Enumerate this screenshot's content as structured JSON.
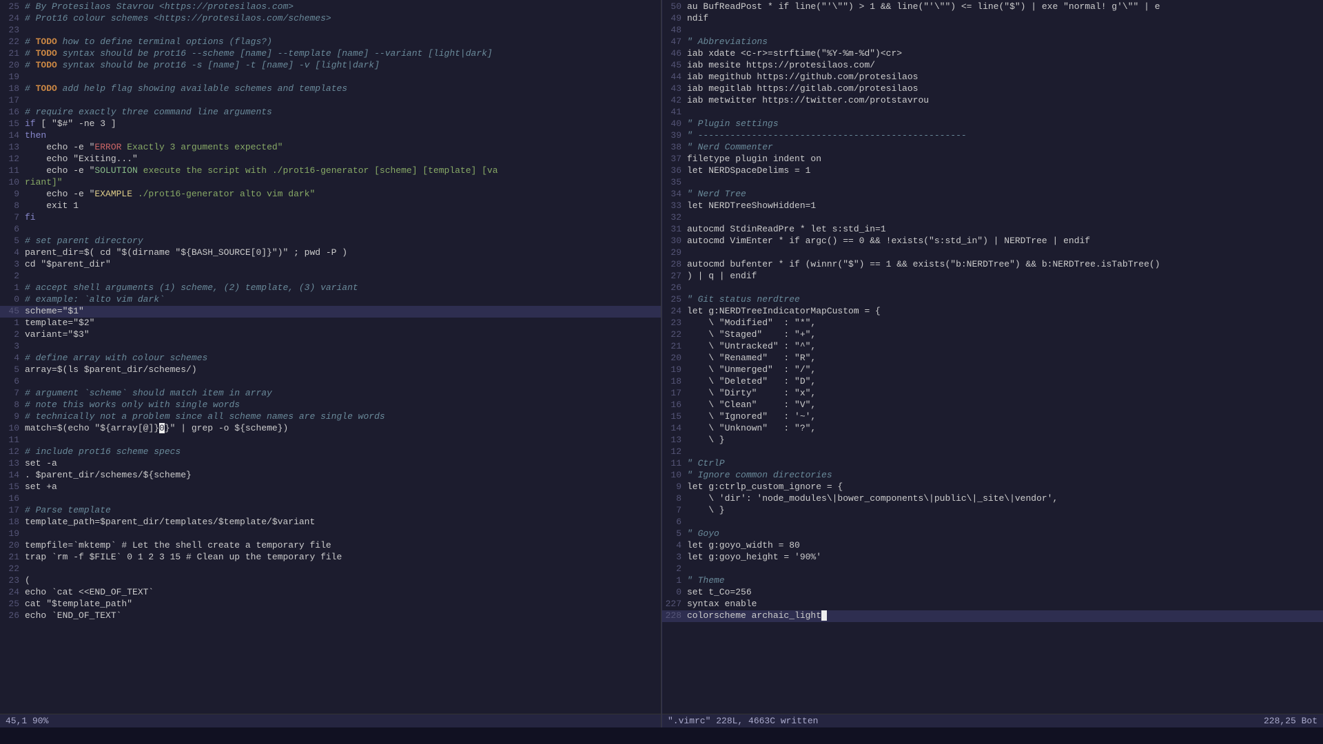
{
  "editor": {
    "left_pane": {
      "lines": [
        {
          "num": 25,
          "content": [
            {
              "t": "# By Protesilaos Stavrou <https://protesilaos.com>",
              "c": "c-comment"
            }
          ]
        },
        {
          "num": 24,
          "content": [
            {
              "t": "# Prot16 colour schemes <https://protesilaos.com/schemes>",
              "c": "c-comment"
            }
          ]
        },
        {
          "num": 23,
          "content": []
        },
        {
          "num": 22,
          "content": [
            {
              "t": "# ",
              "c": "c-comment"
            },
            {
              "t": "TODO",
              "c": "c-todo"
            },
            {
              "t": " how to define terminal options (flags?)",
              "c": "c-comment"
            }
          ]
        },
        {
          "num": 21,
          "content": [
            {
              "t": "# ",
              "c": "c-comment"
            },
            {
              "t": "TODO",
              "c": "c-todo"
            },
            {
              "t": " syntax should be prot16 --scheme [name] --template [name] --variant [light|dark]",
              "c": "c-comment"
            }
          ]
        },
        {
          "num": 20,
          "content": [
            {
              "t": "# ",
              "c": "c-comment"
            },
            {
              "t": "TODO",
              "c": "c-todo"
            },
            {
              "t": " syntax should be prot16 -s [name] -t [name] -v [light|dark]",
              "c": "c-comment"
            }
          ]
        },
        {
          "num": 19,
          "content": []
        },
        {
          "num": 18,
          "content": [
            {
              "t": "# ",
              "c": "c-comment"
            },
            {
              "t": "TODO",
              "c": "c-todo"
            },
            {
              "t": " add help flag showing available schemes and templates",
              "c": "c-comment"
            }
          ]
        },
        {
          "num": 17,
          "content": []
        },
        {
          "num": 16,
          "content": [
            {
              "t": "# require exactly three command line arguments",
              "c": "c-comment"
            }
          ]
        },
        {
          "num": 15,
          "content": [
            {
              "t": "if",
              "c": "c-keyword"
            },
            {
              "t": " [ \"$#\" -ne 3 ]",
              "c": "c-white"
            }
          ]
        },
        {
          "num": 14,
          "content": [
            {
              "t": "then",
              "c": "c-keyword"
            }
          ]
        },
        {
          "num": 13,
          "content": [
            {
              "t": "    echo -e \"",
              "c": "c-white"
            },
            {
              "t": "ERROR",
              "c": "c-red"
            },
            {
              "t": " Exactly 3 arguments expected\"",
              "c": "c-string"
            }
          ]
        },
        {
          "num": 12,
          "content": [
            {
              "t": "    echo \"Exiting...\"",
              "c": "c-white"
            }
          ]
        },
        {
          "num": 11,
          "content": [
            {
              "t": "    echo -e \"",
              "c": "c-white"
            },
            {
              "t": "SOLUTION",
              "c": "c-green"
            },
            {
              "t": " execute the script with ./prot16-generator [scheme] [template] [va",
              "c": "c-string"
            }
          ]
        },
        {
          "num": 10,
          "content": [
            {
              "t": "riant]\"",
              "c": "c-string"
            }
          ]
        },
        {
          "num": 9,
          "content": [
            {
              "t": "    echo -e \"",
              "c": "c-white"
            },
            {
              "t": "EXAMPLE",
              "c": "c-yellow"
            },
            {
              "t": " ./prot16-generator alto vim dark\"",
              "c": "c-string"
            }
          ]
        },
        {
          "num": 8,
          "content": [
            {
              "t": "    exit 1",
              "c": "c-white"
            }
          ]
        },
        {
          "num": 7,
          "content": [
            {
              "t": "fi",
              "c": "c-keyword"
            }
          ]
        },
        {
          "num": 6,
          "content": []
        },
        {
          "num": 5,
          "content": [
            {
              "t": "# set parent directory",
              "c": "c-comment"
            }
          ]
        },
        {
          "num": 4,
          "content": [
            {
              "t": "parent_dir=$( cd \"$(dirname \"${BASH_SOURCE[0]}\")\" ; pwd -P )",
              "c": "c-white"
            }
          ]
        },
        {
          "num": 3,
          "content": [
            {
              "t": "cd \"$parent_dir\"",
              "c": "c-white"
            }
          ]
        },
        {
          "num": 2,
          "content": []
        },
        {
          "num": 1,
          "content": [
            {
              "t": "# accept shell arguments (1) scheme, (2) template, (3) variant",
              "c": "c-comment"
            }
          ]
        },
        {
          "num": 0,
          "content": [
            {
              "t": "# example: `alto vim dark`",
              "c": "c-comment"
            }
          ]
        },
        {
          "num": 45,
          "highlight": true,
          "content": [
            {
              "t": "scheme=\"$1\"",
              "c": "c-white"
            }
          ]
        },
        {
          "num": 1,
          "content": [
            {
              "t": "template=\"$2\"",
              "c": "c-white"
            }
          ]
        },
        {
          "num": 2,
          "content": [
            {
              "t": "variant=\"$3\"",
              "c": "c-white"
            }
          ]
        },
        {
          "num": 3,
          "content": []
        },
        {
          "num": 4,
          "content": [
            {
              "t": "# define array with colour schemes",
              "c": "c-comment"
            }
          ]
        },
        {
          "num": 5,
          "content": [
            {
              "t": "array=$(ls $parent_dir/schemes/)",
              "c": "c-white"
            }
          ]
        },
        {
          "num": 6,
          "content": []
        },
        {
          "num": 7,
          "content": [
            {
              "t": "# argument `scheme` should match item in array",
              "c": "c-comment"
            }
          ]
        },
        {
          "num": 8,
          "content": [
            {
              "t": "# note this works only with single words",
              "c": "c-comment"
            }
          ]
        },
        {
          "num": 9,
          "content": [
            {
              "t": "# technically not a problem since all scheme names are single words",
              "c": "c-comment"
            }
          ]
        },
        {
          "num": 10,
          "content": [
            {
              "t": "match=$(echo \"${array[@]}",
              "c": "c-white"
            },
            {
              "t": "0",
              "c": "c-cursor"
            },
            {
              "t": "}\" | grep -o ${scheme})",
              "c": "c-white"
            }
          ]
        },
        {
          "num": 11,
          "content": []
        },
        {
          "num": 12,
          "content": [
            {
              "t": "# include prot16 scheme specs",
              "c": "c-comment"
            }
          ]
        },
        {
          "num": 13,
          "content": [
            {
              "t": "set -a",
              "c": "c-white"
            }
          ]
        },
        {
          "num": 14,
          "content": [
            {
              "t": ". $parent_dir/schemes/${scheme}",
              "c": "c-white"
            }
          ]
        },
        {
          "num": 15,
          "content": [
            {
              "t": "set +a",
              "c": "c-white"
            }
          ]
        },
        {
          "num": 16,
          "content": []
        },
        {
          "num": 17,
          "content": [
            {
              "t": "# Parse template",
              "c": "c-comment"
            }
          ]
        },
        {
          "num": 18,
          "content": [
            {
              "t": "template_path=$parent_dir/templates/$template/$variant",
              "c": "c-white"
            }
          ]
        },
        {
          "num": 19,
          "content": []
        },
        {
          "num": 20,
          "content": [
            {
              "t": "tempfile=`mktemp` # Let the shell create a temporary file",
              "c": "c-white"
            }
          ]
        },
        {
          "num": 21,
          "content": [
            {
              "t": "trap `rm -f $FILE` 0 1 2 3 15 # Clean up the temporary file",
              "c": "c-white"
            }
          ]
        },
        {
          "num": 22,
          "content": []
        },
        {
          "num": 23,
          "content": [
            {
              "t": "(",
              "c": "c-white"
            }
          ]
        },
        {
          "num": 24,
          "content": [
            {
              "t": "echo `cat <<END_OF_TEXT`",
              "c": "c-white"
            }
          ]
        },
        {
          "num": 25,
          "content": [
            {
              "t": "cat \"$template_path\"",
              "c": "c-white"
            }
          ]
        },
        {
          "num": 26,
          "content": [
            {
              "t": "echo `END_OF_TEXT`",
              "c": "c-white"
            }
          ]
        }
      ],
      "status": "45,1          90%"
    },
    "right_pane": {
      "lines": [
        {
          "num": 50,
          "content": [
            {
              "t": "au BufReadPost * if line(\"'\\\"\") > 1 && line(\"'\\\"\") <= line(\"$\") | exe \"normal! g'\\\"\" | e",
              "c": "c-white"
            }
          ]
        },
        {
          "num": 49,
          "content": [
            {
              "t": "ndif",
              "c": "c-white"
            }
          ]
        },
        {
          "num": 48,
          "content": []
        },
        {
          "num": 47,
          "content": [
            {
              "t": "\" Abbreviations",
              "c": "c-vim-comment"
            }
          ]
        },
        {
          "num": 46,
          "content": [
            {
              "t": "iab xdate <c-r>=strftime(\"%Y-%m-%d\")<cr>",
              "c": "c-white"
            }
          ]
        },
        {
          "num": 45,
          "content": [
            {
              "t": "iab mesite https://protesilaos.com/",
              "c": "c-white"
            }
          ]
        },
        {
          "num": 44,
          "content": [
            {
              "t": "iab megithub https://github.com/protesilaos",
              "c": "c-white"
            }
          ]
        },
        {
          "num": 43,
          "content": [
            {
              "t": "iab megitlab https://gitlab.com/protesilaos",
              "c": "c-white"
            }
          ]
        },
        {
          "num": 42,
          "content": [
            {
              "t": "iab metwitter https://twitter.com/protstavrou",
              "c": "c-white"
            }
          ]
        },
        {
          "num": 41,
          "content": []
        },
        {
          "num": 40,
          "content": [
            {
              "t": "\" Plugin settings",
              "c": "c-vim-comment"
            }
          ]
        },
        {
          "num": 39,
          "content": [
            {
              "t": "\" --------------------------------------------------",
              "c": "c-vim-comment"
            }
          ]
        },
        {
          "num": 38,
          "content": [
            {
              "t": "\" Nerd Commenter",
              "c": "c-vim-comment"
            }
          ]
        },
        {
          "num": 37,
          "content": [
            {
              "t": "filetype plugin indent on",
              "c": "c-white"
            }
          ]
        },
        {
          "num": 36,
          "content": [
            {
              "t": "let NERDSpaceDelims = 1",
              "c": "c-white"
            }
          ]
        },
        {
          "num": 35,
          "content": []
        },
        {
          "num": 34,
          "content": [
            {
              "t": "\" Nerd Tree",
              "c": "c-vim-comment"
            }
          ]
        },
        {
          "num": 33,
          "content": [
            {
              "t": "let NERDTreeShowHidden=1",
              "c": "c-white"
            }
          ]
        },
        {
          "num": 32,
          "content": []
        },
        {
          "num": 31,
          "content": [
            {
              "t": "autocmd StdinReadPre * let s:std_in=1",
              "c": "c-white"
            }
          ]
        },
        {
          "num": 30,
          "content": [
            {
              "t": "autocmd VimEnter * if argc() == 0 && !exists(\"s:std_in\") | NERDTree | endif",
              "c": "c-white"
            }
          ]
        },
        {
          "num": 29,
          "content": []
        },
        {
          "num": 28,
          "content": [
            {
              "t": "autocmd bufenter * if (winnr(\"$\") == 1 && exists(\"b:NERDTree\") && b:NERDTree.isTabTree()",
              "c": "c-white"
            }
          ]
        },
        {
          "num": 27,
          "content": [
            {
              "t": ") | q | endif",
              "c": "c-white"
            }
          ]
        },
        {
          "num": 26,
          "content": []
        },
        {
          "num": 25,
          "content": [
            {
              "t": "\" Git status nerdtree",
              "c": "c-vim-comment"
            }
          ]
        },
        {
          "num": 24,
          "content": [
            {
              "t": "let g:NERDTreeIndicatorMapCustom = {",
              "c": "c-white"
            }
          ]
        },
        {
          "num": 23,
          "content": [
            {
              "t": "    \\ \"Modified\"  : \"*\",",
              "c": "c-white"
            }
          ]
        },
        {
          "num": 22,
          "content": [
            {
              "t": "    \\ \"Staged\"    : \"+\",",
              "c": "c-white"
            }
          ]
        },
        {
          "num": 21,
          "content": [
            {
              "t": "    \\ \"Untracked\" : \"^\",",
              "c": "c-white"
            }
          ]
        },
        {
          "num": 20,
          "content": [
            {
              "t": "    \\ \"Renamed\"   : \"R\",",
              "c": "c-white"
            }
          ]
        },
        {
          "num": 19,
          "content": [
            {
              "t": "    \\ \"Unmerged\"  : \"/\",",
              "c": "c-white"
            }
          ]
        },
        {
          "num": 18,
          "content": [
            {
              "t": "    \\ \"Deleted\"   : \"D\",",
              "c": "c-white"
            }
          ]
        },
        {
          "num": 17,
          "content": [
            {
              "t": "    \\ \"Dirty\"     : \"x\",",
              "c": "c-white"
            }
          ]
        },
        {
          "num": 16,
          "content": [
            {
              "t": "    \\ \"Clean\"     : \"V\",",
              "c": "c-white"
            }
          ]
        },
        {
          "num": 15,
          "content": [
            {
              "t": "    \\ \"Ignored\"   : '~',",
              "c": "c-white"
            }
          ]
        },
        {
          "num": 14,
          "content": [
            {
              "t": "    \\ \"Unknown\"   : \"?\",",
              "c": "c-white"
            }
          ]
        },
        {
          "num": 13,
          "content": [
            {
              "t": "    \\ }",
              "c": "c-white"
            }
          ]
        },
        {
          "num": 12,
          "content": []
        },
        {
          "num": 11,
          "content": [
            {
              "t": "\" CtrlP",
              "c": "c-vim-comment"
            }
          ]
        },
        {
          "num": 10,
          "content": [
            {
              "t": "\" Ignore common directories",
              "c": "c-vim-comment"
            }
          ]
        },
        {
          "num": 9,
          "content": [
            {
              "t": "let g:ctrlp_custom_ignore = {",
              "c": "c-white"
            }
          ]
        },
        {
          "num": 8,
          "content": [
            {
              "t": "    \\ 'dir': 'node_modules\\|bower_components\\|public\\|_site\\|vendor',",
              "c": "c-white"
            }
          ]
        },
        {
          "num": 7,
          "content": [
            {
              "t": "    \\ }",
              "c": "c-white"
            }
          ]
        },
        {
          "num": 6,
          "content": []
        },
        {
          "num": 5,
          "content": [
            {
              "t": "\" Goyo",
              "c": "c-vim-comment"
            }
          ]
        },
        {
          "num": 4,
          "content": [
            {
              "t": "let g:goyo_width = 80",
              "c": "c-white"
            }
          ]
        },
        {
          "num": 3,
          "content": [
            {
              "t": "let g:goyo_height = '90%'",
              "c": "c-white"
            }
          ]
        },
        {
          "num": 2,
          "content": []
        },
        {
          "num": 1,
          "content": [
            {
              "t": "\" Theme",
              "c": "c-vim-comment"
            }
          ]
        },
        {
          "num": 0,
          "content": [
            {
              "t": "set t_Co=256",
              "c": "c-white"
            }
          ]
        },
        {
          "num": 227,
          "content": [
            {
              "t": "syntax enable",
              "c": "c-white"
            }
          ]
        },
        {
          "num": 228,
          "highlight": true,
          "content": [
            {
              "t": "colorscheme archaic_light",
              "c": "c-white"
            },
            {
              "t": " ",
              "c": "c-cursor"
            }
          ]
        }
      ],
      "status_left": "228,25",
      "status_right": "Bot",
      "filename": "\".vimrc\" 228L, 4663C written"
    }
  }
}
